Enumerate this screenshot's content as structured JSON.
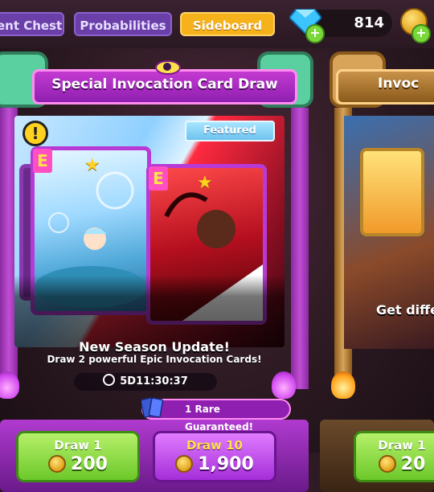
{
  "tabs": [
    {
      "label": "ent Chests",
      "active": false
    },
    {
      "label": "Probabilities",
      "active": false
    },
    {
      "label": "Sideboard",
      "active": true
    }
  ],
  "currency": {
    "gems": "814",
    "gem_icon": "gem-icon",
    "coin_icon": "coin-icon",
    "plus": "+"
  },
  "banner": {
    "title": "Special Invocation Card Draw",
    "featured_label": "Featured",
    "alert_symbol": "!",
    "card_badge": "E",
    "update_title": "New Season Update!",
    "update_subtitle": "Draw 2 powerful Epic Invocation Cards!",
    "timer": "5D11:30:37",
    "guarantee": "1 Rare Guaranteed!",
    "buttons": [
      {
        "label": "Draw 1",
        "price": "200",
        "style": "green"
      },
      {
        "label": "Draw 10",
        "price": "1,900",
        "style": "purple"
      }
    ]
  },
  "next_banner": {
    "title": "Invoc",
    "subtitle": "Get diffe",
    "button_label": "Draw 1",
    "button_price": "20"
  },
  "colors": {
    "accent_purple": "#8f1fb0",
    "tab_active": "#f6b21b",
    "button_green": "#6cc82a"
  }
}
